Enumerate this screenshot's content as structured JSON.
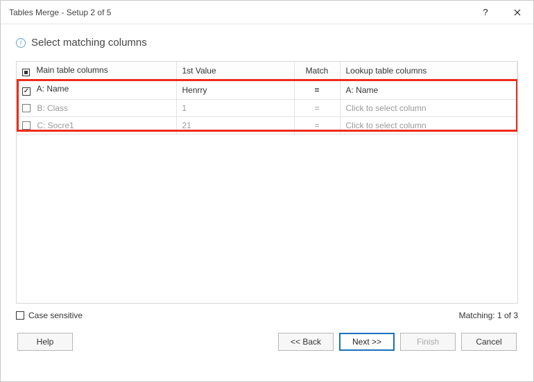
{
  "titlebar": {
    "title": "Tables Merge - Setup 2 of 5",
    "help": "?",
    "close": "✕"
  },
  "heading": {
    "info": "i",
    "text": "Select matching columns"
  },
  "grid": {
    "headers": {
      "main": "Main table columns",
      "value": "1st Value",
      "match": "Match",
      "lookup": "Lookup table columns"
    },
    "rows": [
      {
        "checked": true,
        "main": "A: Name",
        "value": "Henrry",
        "match": "=",
        "lookup": "A: Name",
        "active": true
      },
      {
        "checked": false,
        "main": "B: Class",
        "value": "1",
        "match": "=",
        "lookup": "Click to select column",
        "active": false
      },
      {
        "checked": false,
        "main": "C: Socre1",
        "value": "21",
        "match": "=",
        "lookup": "Click to select column",
        "active": false
      }
    ]
  },
  "bottom": {
    "case_sensitive": "Case sensitive",
    "matching": "Matching: 1 of 3"
  },
  "buttons": {
    "help": "Help",
    "back": "<< Back",
    "next": "Next >>",
    "finish": "Finish",
    "cancel": "Cancel"
  }
}
